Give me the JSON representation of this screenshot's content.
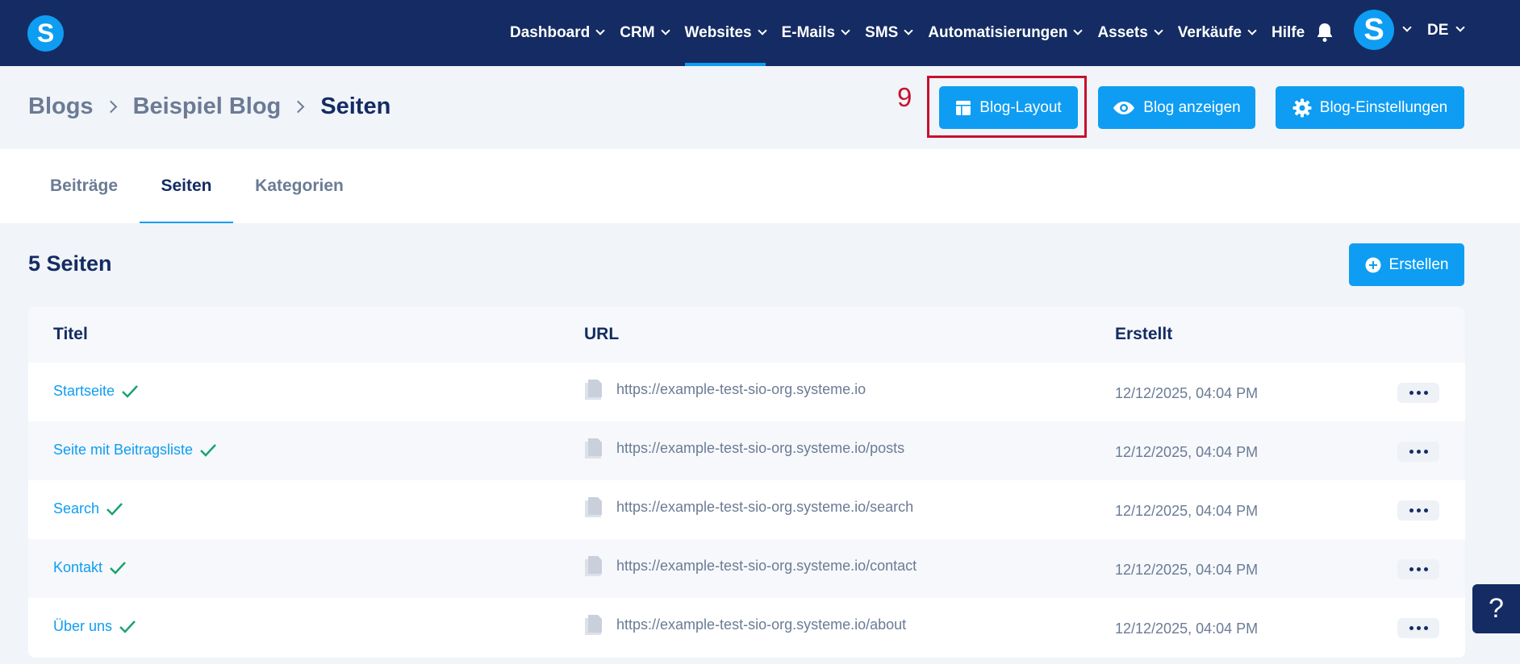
{
  "app": {
    "logo_letter": "S",
    "avatar_letter": "S",
    "language": "DE"
  },
  "nav": {
    "items": [
      {
        "label": "Dashboard",
        "has_dropdown": true,
        "active": false
      },
      {
        "label": "CRM",
        "has_dropdown": true,
        "active": false
      },
      {
        "label": "Websites",
        "has_dropdown": true,
        "active": true
      },
      {
        "label": "E-Mails",
        "has_dropdown": true,
        "active": false
      },
      {
        "label": "SMS",
        "has_dropdown": true,
        "active": false
      },
      {
        "label": "Automatisierungen",
        "has_dropdown": true,
        "active": false
      },
      {
        "label": "Assets",
        "has_dropdown": true,
        "active": false
      },
      {
        "label": "Verkäufe",
        "has_dropdown": true,
        "active": false
      },
      {
        "label": "Hilfe",
        "has_dropdown": false,
        "active": false
      }
    ]
  },
  "breadcrumb": [
    "Blogs",
    "Beispiel Blog",
    "Seiten"
  ],
  "annotation": {
    "step_number": "9"
  },
  "header_buttons": {
    "blog_layout": "Blog-Layout",
    "blog_view": "Blog anzeigen",
    "blog_settings": "Blog-Einstellungen"
  },
  "tabs": [
    {
      "label": "Beiträge",
      "active": false
    },
    {
      "label": "Seiten",
      "active": true
    },
    {
      "label": "Kategorien",
      "active": false
    }
  ],
  "content": {
    "count_title": "5 Seiten",
    "create_label": "Erstellen"
  },
  "table": {
    "headers": {
      "title": "Titel",
      "url": "URL",
      "created": "Erstellt"
    },
    "rows": [
      {
        "title": "Startseite",
        "url": "https://example-test-sio-org.systeme.io",
        "created": "12/12/2025, 04:04 PM"
      },
      {
        "title": "Seite mit Beitragsliste",
        "url": "https://example-test-sio-org.systeme.io/posts",
        "created": "12/12/2025, 04:04 PM"
      },
      {
        "title": "Search",
        "url": "https://example-test-sio-org.systeme.io/search",
        "created": "12/12/2025, 04:04 PM"
      },
      {
        "title": "Kontakt",
        "url": "https://example-test-sio-org.systeme.io/contact",
        "created": "12/12/2025, 04:04 PM"
      },
      {
        "title": "Über uns",
        "url": "https://example-test-sio-org.systeme.io/about",
        "created": "12/12/2025, 04:04 PM"
      }
    ]
  },
  "help": {
    "label": "?"
  },
  "colors": {
    "navy": "#142c63",
    "accent": "#0e9df2",
    "highlight": "#c8102e",
    "check": "#1aa36f"
  },
  "icons": {
    "bell": "bell-icon",
    "layout": "layout-icon",
    "eye": "eye-icon",
    "gear": "gear-icon",
    "plus": "plus-circle-icon",
    "check": "check-icon",
    "file": "file-icon",
    "more": "more-dots-icon"
  }
}
